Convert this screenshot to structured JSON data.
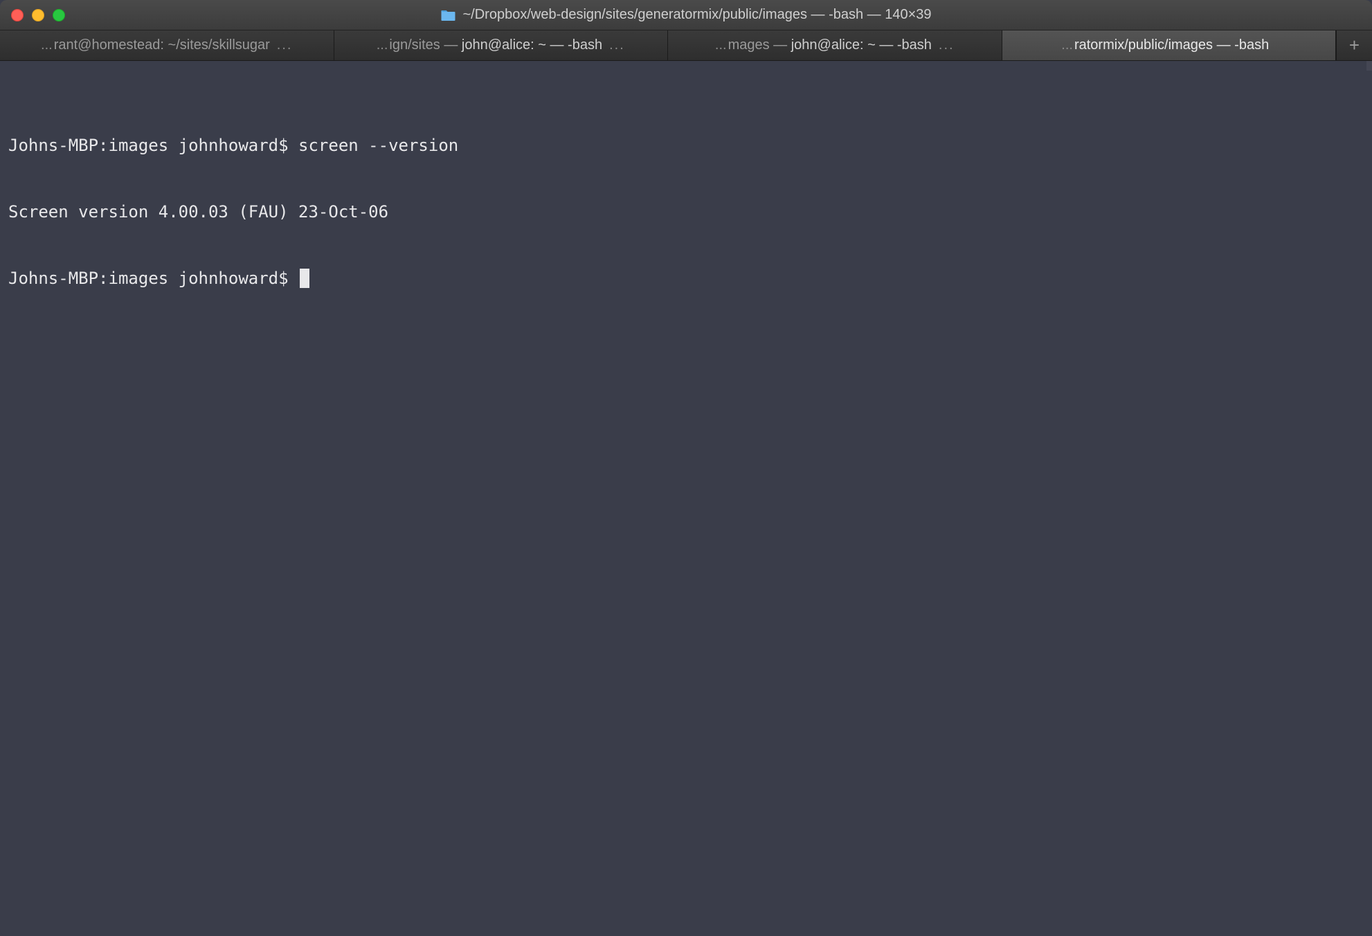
{
  "window": {
    "title": "~/Dropbox/web-design/sites/generatormix/public/images — -bash — 140×39"
  },
  "tabs": [
    {
      "prefix": "...",
      "dimText": "rant@homestead: ~/sites/skillsugar",
      "brightText": "",
      "suffixEllipsis": "...",
      "active": false
    },
    {
      "prefix": "...",
      "dimText": "ign/sites — ",
      "brightText": "john@alice: ~ — -bash",
      "suffixEllipsis": "...",
      "active": false
    },
    {
      "prefix": "...",
      "dimText": "mages — ",
      "brightText": "john@alice: ~ — -bash",
      "suffixEllipsis": "...",
      "active": false
    },
    {
      "prefix": "...",
      "dimText": "ratormix/public/images — ",
      "brightText": "-bash",
      "suffixEllipsis": "",
      "active": true
    }
  ],
  "newTabGlyph": "+",
  "terminal": {
    "lines": [
      {
        "prompt": "Johns-MBP:images johnhoward$ ",
        "command": "screen --version"
      },
      {
        "output": "Screen version 4.00.03 (FAU) 23-Oct-06"
      },
      {
        "prompt": "Johns-MBP:images johnhoward$ ",
        "command": ""
      }
    ]
  }
}
